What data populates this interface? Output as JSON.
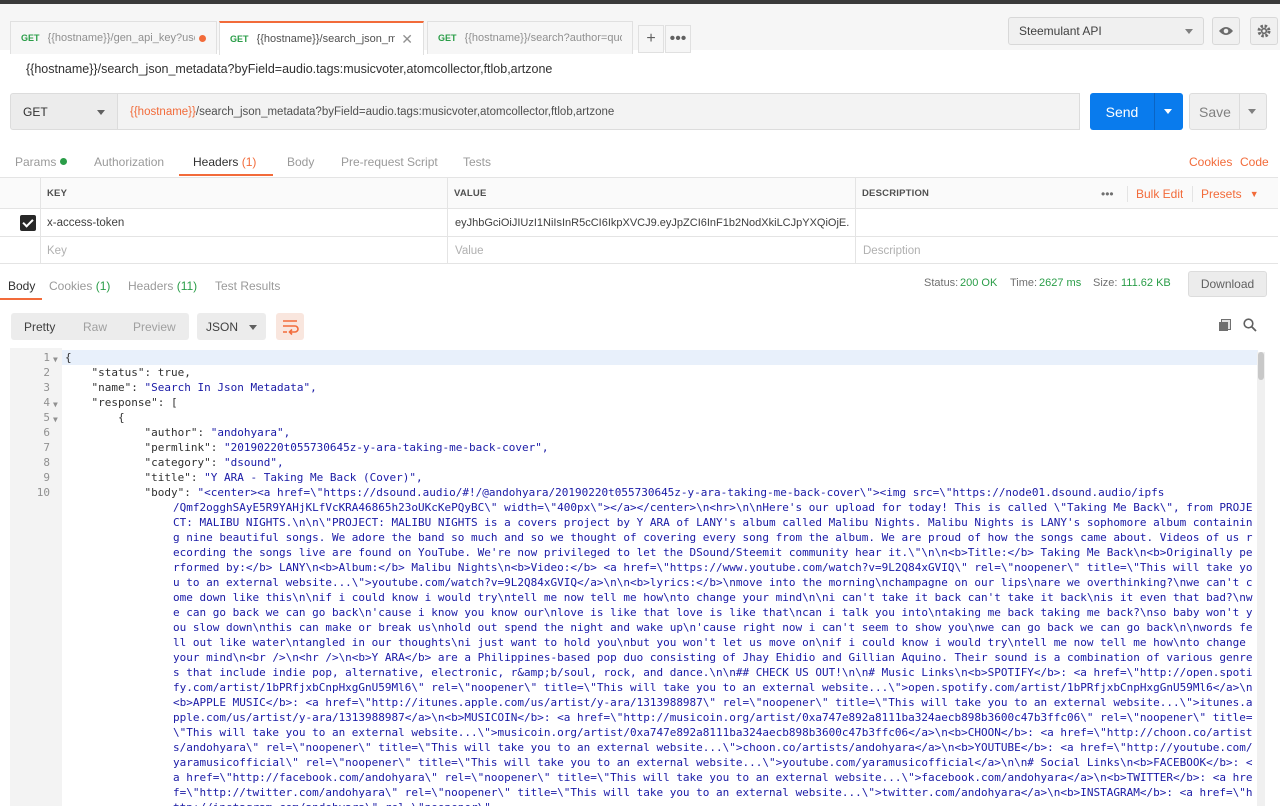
{
  "tabs": [
    {
      "method": "GET",
      "url": "{{hostname}}/gen_api_key?user=",
      "unsaved": true
    },
    {
      "method": "GET",
      "url": "{{hostname}}/search_json_meta",
      "active": true
    },
    {
      "method": "GET",
      "url": "{{hostname}}/search?author=quoch"
    }
  ],
  "environment": "Steemulant API",
  "request_title": "{{hostname}}/search_json_metadata?byField=audio.tags:musicvoter,atomcollector,ftlob,artzone",
  "url_bar": {
    "method": "GET",
    "url_var": "{{hostname}}",
    "url_rest": "/search_json_metadata?byField=audio.tags:musicvoter,atomcollector,ftlob,artzone",
    "send": "Send",
    "save": "Save"
  },
  "request_tabs": {
    "params": "Params",
    "authorization": "Authorization",
    "headers": "Headers",
    "headers_count": "(1)",
    "body": "Body",
    "prerequest": "Pre-request Script",
    "tests": "Tests",
    "cookies": "Cookies",
    "code": "Code"
  },
  "headers_table": {
    "col_key": "KEY",
    "col_value": "VALUE",
    "col_description": "DESCRIPTION",
    "bulk_edit": "Bulk Edit",
    "presets": "Presets",
    "rows": [
      {
        "key": "x-access-token",
        "value": "eyJhbGciOiJIUzI1NiIsInR5cCI6IkpXVCJ9.eyJpZCI6InF1b2NodXkiLCJpYXQiOjE...",
        "description": ""
      }
    ],
    "placeholder": {
      "key": "Key",
      "value": "Value",
      "description": "Description"
    }
  },
  "response": {
    "tabs": {
      "body": "Body",
      "cookies": "Cookies",
      "cookies_count": "(1)",
      "headers": "Headers",
      "headers_count": "(11)",
      "tests": "Test Results"
    },
    "status_label": "Status:",
    "status": "200 OK",
    "time_label": "Time:",
    "time": "2627 ms",
    "size_label": "Size:",
    "size": "111.62 KB",
    "download": "Download",
    "view": {
      "pretty": "Pretty",
      "raw": "Raw",
      "preview": "Preview",
      "format": "JSON"
    }
  },
  "code": {
    "lines": [
      {
        "n": "1",
        "fold": true,
        "text": "{"
      },
      {
        "n": "2",
        "key": "\"status\"",
        "val": "true,",
        "indent": 4,
        "plain": true
      },
      {
        "n": "3",
        "key": "\"name\"",
        "val": "\"Search In Json Metadata\",",
        "indent": 4
      },
      {
        "n": "4",
        "fold": true,
        "key": "\"response\"",
        "val": "[",
        "indent": 4,
        "plain": true
      },
      {
        "n": "5",
        "fold": true,
        "text": "        {"
      },
      {
        "n": "6",
        "key": "\"author\"",
        "val": "\"andohyara\",",
        "indent": 12
      },
      {
        "n": "7",
        "key": "\"permlink\"",
        "val": "\"20190220t055730645z-y-ara-taking-me-back-cover\",",
        "indent": 12
      },
      {
        "n": "8",
        "key": "\"category\"",
        "val": "\"dsound\",",
        "indent": 12
      },
      {
        "n": "9",
        "key": "\"title\"",
        "val": "\"Y ARA - Taking Me Back (Cover)\",",
        "indent": 12
      },
      {
        "n": "10",
        "key": "\"body\"",
        "val": "\"<center><a href=\\\"https://dsound.audio/#!/@andohyara/20190220t055730645z-y-ara-taking-me-back-cover\\\"><img src=\\\"https://node01.dsound.audio/ipfs",
        "indent": 12
      }
    ],
    "body_continued": "/Qmf2ogghSAyE5R9YAHjKLfVcKRA46865h23oUKcKePQyBC\\\" width=\\\"400px\\\"></a></center>\\n<hr>\\n\\nHere's our upload for today! This is called \\\"Taking Me Back\\\", from PROJECT: MALIBU NIGHTS.\\n\\n\\\"PROJECT: MALIBU NIGHTS is a covers project by Y ARA of LANY's album called Malibu Nights. Malibu Nights is LANY's sophomore album containing nine beautiful songs. We adore the band so much and so we thought of covering every song from the album. We are proud of how the songs came about. Videos of us recording the songs live are found on YouTube. We're now privileged to let the DSound/Steemit community hear it.\\\"\\n\\n<b>Title:</b> Taking Me Back\\n<b>Originally performed by:</b> LANY\\n<b>Album:</b> Malibu Nights\\n<b>Video:</b> <a href=\\\"https://www.youtube.com/watch?v=9L2Q84xGVIQ\\\" rel=\\\"noopener\\\" title=\\\"This will take you to an external website...\\\">youtube.com/watch?v=9L2Q84xGVIQ</a>\\n\\n<b>lyrics:</b>\\nmove into the morning\\nchampagne on our lips\\nare we overthinking?\\nwe can't come down like this\\n\\nif i could know i would try\\ntell me now tell me how\\nto change your mind\\n\\ni can't take it back can't take it back\\nis it even that bad?\\nwe can go back we can go back\\n'cause i know you know our\\nlove is like that love is like that\\ncan i talk you into\\ntaking me back taking me back?\\nso baby won't you slow down\\nthis can make or break us\\nhold out spend the night and wake up\\n'cause right now i can't seem to show you\\nwe can go back we can go back\\n\\nwords fell out like water\\ntangled in our thoughts\\ni just want to hold you\\nbut you won't let us move on\\nif i could know i would try\\ntell me now tell me how\\nto change your mind\\n<br />\\n<hr />\\n<b>Y ARA</b> are a Philippines-based pop duo consisting of Jhay Ehidio and Gillian Aquino. Their sound is a combination of various genres that include indie pop, alternative, electronic, r&amp;b/soul, rock, and dance.\\n\\n## CHECK US OUT!\\n\\n# Music Links\\n<b>SPOTIFY</b>: <a href=\\\"http://open.spotify.com/artist/1bPRfjxbCnpHxgGnU59Ml6\\\" rel=\\\"noopener\\\" title=\\\"This will take you to an external website...\\\">open.spotify.com/artist/1bPRfjxbCnpHxgGnU59Ml6</a>\\n<b>APPLE MUSIC</b>: <a href=\\\"http://itunes.apple.com/us/artist/y-ara/1313988987\\\" rel=\\\"noopener\\\" title=\\\"This will take you to an external website...\\\">itunes.apple.com/us/artist/y-ara/1313988987</a>\\n<b>MUSICOIN</b>: <a href=\\\"http://musicoin.org/artist/0xa747e892a8111ba324aecb898b3600c47b3ffc06\\\" rel=\\\"noopener\\\" title=\\\"This will take you to an external website...\\\">musicoin.org/artist/0xa747e892a8111ba324aecb898b3600c47b3ffc06</a>\\n<b>CHOON</b>: <a href=\\\"http://choon.co/artists/andohyara\\\" rel=\\\"noopener\\\" title=\\\"This will take you to an external website...\\\">choon.co/artists/andohyara</a>\\n<b>YOUTUBE</b>: <a href=\\\"http://youtube.com/yaramusicofficial\\\" rel=\\\"noopener\\\" title=\\\"This will take you to an external website...\\\">youtube.com/yaramusicofficial</a>\\n\\n# Social Links\\n<b>FACEBOOK</b>: <a href=\\\"http://facebook.com/andohyara\\\" rel=\\\"noopener\\\" title=\\\"This will take you to an external website...\\\">facebook.com/andohyara</a>\\n<b>TWITTER</b>: <a href=\\\"http://twitter.com/andohyara\\\" rel=\\\"noopener\\\" title=\\\"This will take you to an external website...\\\">twitter.com/andohyara</a>\\n<b>INSTAGRAM</b>: <a href=\\\"http://instagram.com/andohyara\\\" rel=\\\"noopener\\\""
  }
}
